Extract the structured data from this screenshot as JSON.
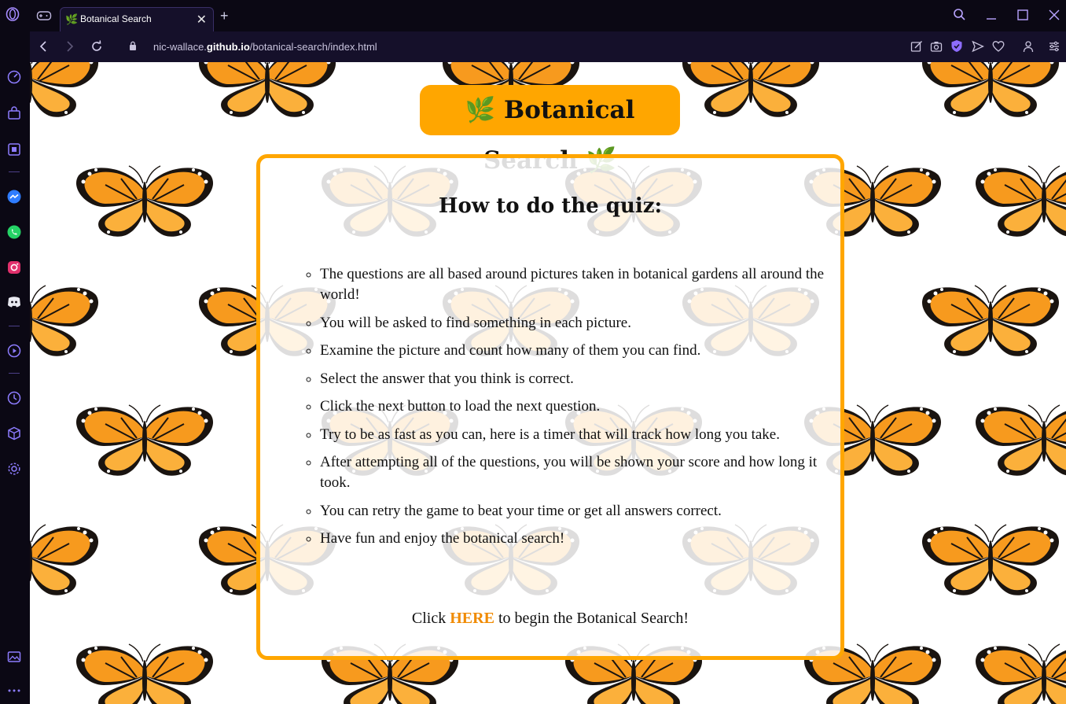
{
  "browser": {
    "tab_title": "Botanical Search",
    "tab_close": "✕",
    "new_tab": "+",
    "url_prefix": "nic-wallace.",
    "url_domain": "github.io",
    "url_path": "/botanical-search/index.html"
  },
  "page": {
    "header_title": "🌿 Botanical Search 🌿",
    "quiz_heading": "How to do the quiz:",
    "instructions": [
      "The questions are all based around pictures taken in botanical gardens all around the world!",
      "You will be asked to find something in each picture.",
      "Examine the picture and count how many of them you can find.",
      "Select the answer that you think is correct.",
      "Click the next button to load the next question.",
      "Try to be as fast as you can, here is a timer that will track how long you take.",
      "After attempting all of the questions, you will be shown your score and how long it took.",
      "You can retry the game to beat your time or get all answers correct.",
      "Have fun and enjoy the botanical search!"
    ],
    "begin_prefix": "Click ",
    "begin_link": "HERE",
    "begin_suffix": " to begin the Botanical Search!"
  },
  "colors": {
    "accent": "#ffa600",
    "link": "#f08a00",
    "browser_chrome": "#0b0814",
    "sidebar_icon": "#8d7cff"
  }
}
